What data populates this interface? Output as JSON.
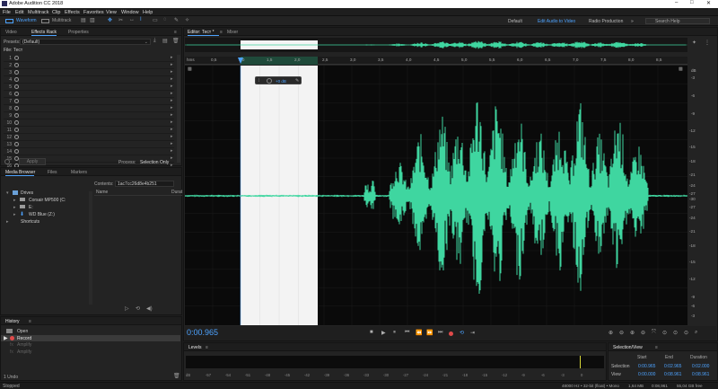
{
  "window": {
    "title": "Adobe Audition CC 2018",
    "min": "–",
    "max": "□",
    "close": "✕"
  },
  "menu": [
    "File",
    "Edit",
    "Multitrack",
    "Clip",
    "Effects",
    "Favorites",
    "View",
    "Window",
    "Help"
  ],
  "toolbar": {
    "waveform": "Waveform",
    "multitrack": "Multitrack"
  },
  "workspaces": {
    "default": "Default",
    "edit_audio": "Edit Audio to Video",
    "radio": "Radio Production"
  },
  "search": {
    "placeholder": "Search Help"
  },
  "left_tabs": [
    "Video",
    "Effects Rack",
    "Properties"
  ],
  "effects_rack": {
    "presets_label": "Presets:",
    "presets_value": "(Default)",
    "file_label": "File: Тест",
    "slots": [
      "1",
      "2",
      "3",
      "4",
      "5",
      "6",
      "7",
      "8",
      "9",
      "10",
      "11",
      "12",
      "13",
      "14",
      "15",
      "16"
    ],
    "apply_button": "Apply",
    "process_label": "Process:",
    "process_value": "Selection Only"
  },
  "media_browser": {
    "tabs": [
      "Media Browser",
      "Files",
      "Markers"
    ],
    "contents_label": "Contents:",
    "contents_value": "1ac7cc26d8e4b251",
    "col_name": "Name",
    "col_duration": "Durat",
    "tree": {
      "drives": "Drives",
      "d1": "Corsair MP500 (C:",
      "d2": "E:",
      "d3": "WD Blue (Z:)",
      "shortcuts": "Shortcuts"
    }
  },
  "history": {
    "title": "History",
    "items": [
      "Open",
      "Record",
      "Amplify",
      "Amplify"
    ],
    "undo_count": "1 Undo"
  },
  "status": {
    "left": "Stopped",
    "right1": "48000 Hz • 32-bit (float) • Mono",
    "right2": "1,64 MB",
    "right3": "0:08,961",
    "right4": "55,04 GB free"
  },
  "editor": {
    "tabs": [
      "Editor: Тест *",
      "Mixer"
    ],
    "time_display": "0:00.965",
    "hud_value": "+0 dB",
    "ruler_unit": "hms",
    "ruler": [
      "0,5",
      "1,0",
      "1,5",
      "2,0",
      "2,5",
      "3,0",
      "3,5",
      "4,0",
      "4,5",
      "5,0",
      "5,5",
      "6,0",
      "6,5",
      "7,0",
      "7,5",
      "8,0",
      "8,5"
    ],
    "db_scale": [
      "dB",
      "-3",
      "-6",
      "-9",
      "-12",
      "-15",
      "-18",
      "-21",
      "-24",
      "-27",
      "-30",
      "-27",
      "-24",
      "-21",
      "-18",
      "-15",
      "-12",
      "-9",
      "-6",
      "-3"
    ]
  },
  "levels": {
    "title": "Levels",
    "scale": [
      "dB",
      "-57",
      "-54",
      "-51",
      "-48",
      "-45",
      "-42",
      "-39",
      "-36",
      "-33",
      "-30",
      "-27",
      "-24",
      "-21",
      "-18",
      "-15",
      "-12",
      "-9",
      "-6",
      "-3",
      "0"
    ]
  },
  "selection_view": {
    "title": "Selection/View",
    "headers": [
      "Start",
      "End",
      "Duration"
    ],
    "rows": [
      {
        "label": "Selection",
        "start": "0:00.965",
        "end": "0:02.965",
        "duration": "0:02.000"
      },
      {
        "label": "View",
        "start": "0:00.000",
        "end": "0:08.961",
        "duration": "0:08.961"
      }
    ]
  },
  "colors": {
    "accent": "#4da3ff",
    "waveform": "#3fd6a0",
    "selection": "#f2f2f2"
  }
}
